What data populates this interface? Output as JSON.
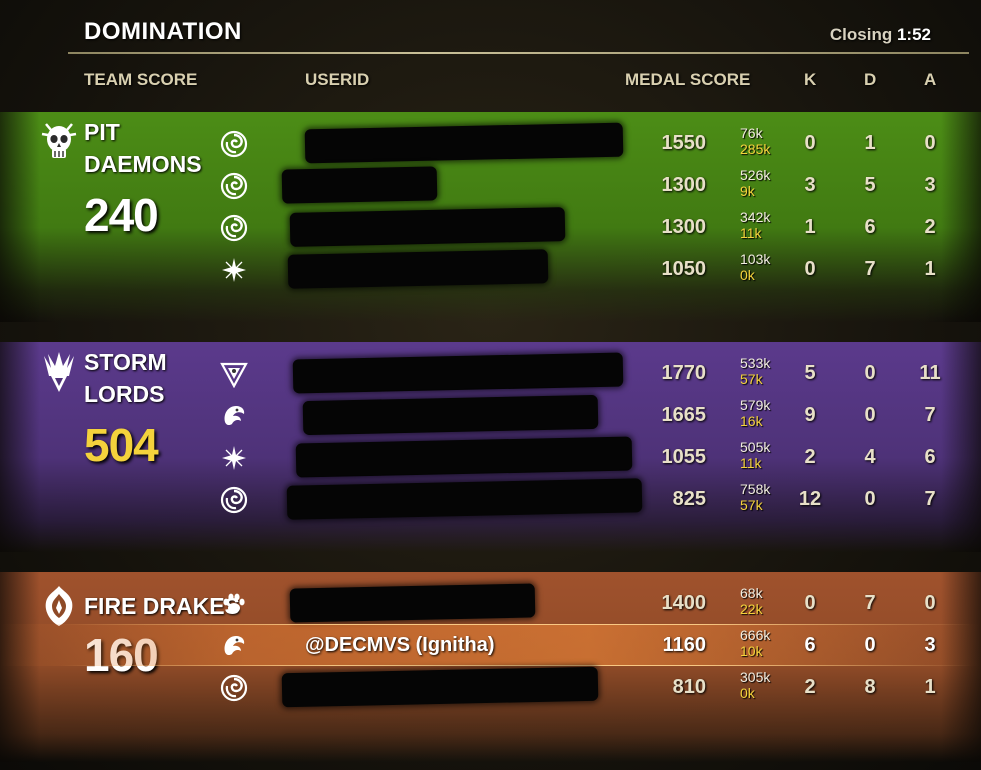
{
  "header": {
    "mode": "DOMINATION",
    "closing_label": "Closing",
    "closing_time": "1:52"
  },
  "columns": {
    "team_score": "TEAM SCORE",
    "userid": "USERID",
    "medal_score": "MEDAL SCORE",
    "k": "K",
    "d": "D",
    "a": "A"
  },
  "colors": {
    "green_team": "#4c8d16",
    "purple_team": "#5b3a8c",
    "orange_team": "#a0522d",
    "lead_score": "#f4d23c",
    "healing": "#f4d23c"
  },
  "teams": [
    {
      "name_line1": "PIT",
      "name_line2": "DAEMONS",
      "score": "240",
      "emblem": "pit-daemons-skull-icon",
      "players": [
        {
          "class_icon": "dragonknight-swirl-icon",
          "userid": "",
          "medal": "1550",
          "damage": "76k",
          "healing": "285k",
          "k": "0",
          "d": "1",
          "a": "0"
        },
        {
          "class_icon": "dragonknight-swirl-icon",
          "userid": "",
          "medal": "1300",
          "damage": "526k",
          "healing": "9k",
          "k": "3",
          "d": "5",
          "a": "3"
        },
        {
          "class_icon": "dragonknight-swirl-icon",
          "userid": "",
          "medal": "1300",
          "damage": "342k",
          "healing": "11k",
          "k": "1",
          "d": "6",
          "a": "2"
        },
        {
          "class_icon": "nightblade-star-icon",
          "userid": "",
          "medal": "1050",
          "damage": "103k",
          "healing": "0k",
          "k": "0",
          "d": "7",
          "a": "1"
        }
      ]
    },
    {
      "name_line1": "STORM",
      "name_line2": "LORDS",
      "score": "504",
      "emblem": "storm-lords-crown-icon",
      "players": [
        {
          "class_icon": "sorcerer-triangle-icon",
          "userid": "",
          "medal": "1770",
          "damage": "533k",
          "healing": "57k",
          "k": "5",
          "d": "0",
          "a": "11"
        },
        {
          "class_icon": "dragon-head-icon",
          "userid": "",
          "medal": "1665",
          "damage": "579k",
          "healing": "16k",
          "k": "9",
          "d": "0",
          "a": "7"
        },
        {
          "class_icon": "nightblade-star-icon",
          "userid": "",
          "medal": "1055",
          "damage": "505k",
          "healing": "11k",
          "k": "2",
          "d": "4",
          "a": "6"
        },
        {
          "class_icon": "dragonknight-swirl-icon",
          "userid": "",
          "medal": "825",
          "damage": "758k",
          "healing": "57k",
          "k": "12",
          "d": "0",
          "a": "7"
        }
      ]
    },
    {
      "name_line1": "FIRE DRAKES",
      "name_line2": "",
      "score": "160",
      "emblem": "fire-drakes-emblem-icon",
      "players": [
        {
          "class_icon": "paw-print-icon",
          "userid": "",
          "medal": "1400",
          "damage": "68k",
          "healing": "22k",
          "k": "0",
          "d": "7",
          "a": "0"
        },
        {
          "class_icon": "dragon-head-icon",
          "userid": "@DECMVS (Ignitha)",
          "medal": "1160",
          "damage": "666k",
          "healing": "10k",
          "k": "6",
          "d": "0",
          "a": "3"
        },
        {
          "class_icon": "dragonknight-swirl-icon",
          "userid": "",
          "medal": "810",
          "damage": "305k",
          "healing": "0k",
          "k": "2",
          "d": "8",
          "a": "1"
        }
      ]
    }
  ]
}
